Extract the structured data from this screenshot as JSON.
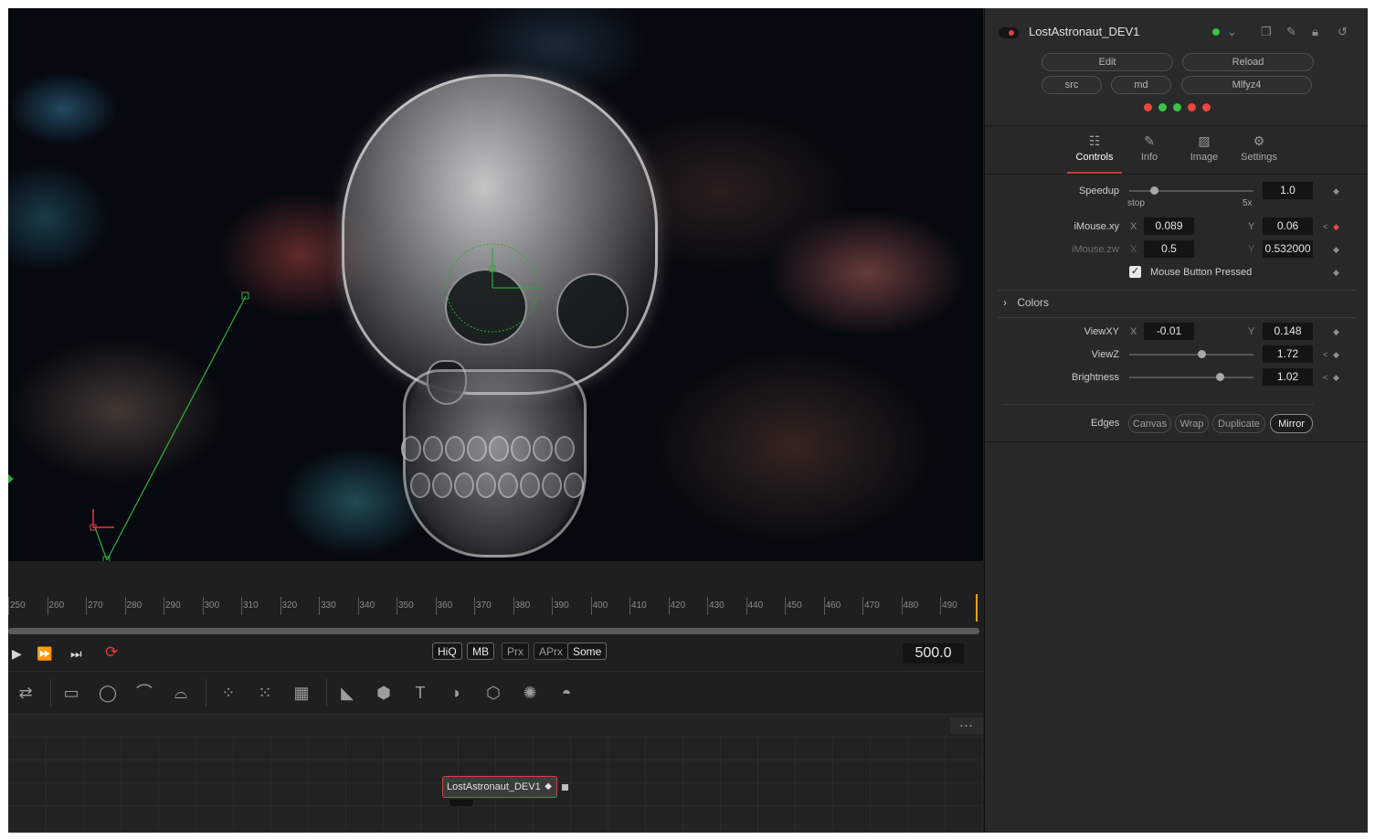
{
  "tool": {
    "title": "LostAstronaut_DEV1",
    "buttons_row1": [
      "Edit",
      "Reload"
    ],
    "buttons_row2": [
      "src",
      "md",
      "Mlfyz4"
    ],
    "status_dots": [
      "#e8493c",
      "#3cc24a",
      "#3cc24a",
      "#e8493c",
      "#e8493c"
    ]
  },
  "tabs": [
    {
      "label": "Controls",
      "icon": "sliders-icon"
    },
    {
      "label": "Info",
      "icon": "edit-icon"
    },
    {
      "label": "Image",
      "icon": "image-icon"
    },
    {
      "label": "Settings",
      "icon": "settings-icon"
    }
  ],
  "controls": {
    "speedup": {
      "label": "Speedup",
      "value": "1.0",
      "min_label": "stop",
      "max_label": "5x",
      "level": 0.2
    },
    "imouse_xy": {
      "label": "iMouse.xy",
      "x_label": "X",
      "x": "0.089",
      "y_label": "Y",
      "y": "0.06"
    },
    "imouse_zw": {
      "label": "iMouse.zw",
      "x_label": "X",
      "x": "0.5",
      "y_label": "Y",
      "y": "0.532000"
    },
    "mouse_pressed": {
      "label": "Mouse Button Pressed",
      "checked": true
    },
    "colors_section": "Colors",
    "viewxy": {
      "label": "ViewXY",
      "x_label": "X",
      "x": "-0.01",
      "y_label": "Y",
      "y": "0.148"
    },
    "viewz": {
      "label": "ViewZ",
      "value": "1.72",
      "level": 0.58
    },
    "brightness": {
      "label": "Brightness",
      "value": "1.02",
      "level": 0.73
    },
    "edges": {
      "label": "Edges",
      "options": [
        "Canvas",
        "Wrap",
        "Duplicate",
        "Mirror"
      ],
      "selected": "Mirror"
    }
  },
  "timeline": {
    "ticks": [
      "250",
      "260",
      "270",
      "280",
      "290",
      "300",
      "310",
      "320",
      "330",
      "340",
      "350",
      "360",
      "370",
      "380",
      "390",
      "400",
      "410",
      "420",
      "430",
      "440",
      "450",
      "460",
      "470",
      "480",
      "490"
    ],
    "current_frame": "500.0"
  },
  "transport": {
    "quality_buttons": [
      "HiQ",
      "MB",
      "Prx",
      "APrx",
      "Some"
    ],
    "active_quality": [
      "HiQ",
      "MB",
      "Some"
    ]
  },
  "node": {
    "label": "LostAstronaut_DEV1"
  },
  "colors": {
    "accent_red": "#c93a3a",
    "status_green": "#3cc24a"
  }
}
